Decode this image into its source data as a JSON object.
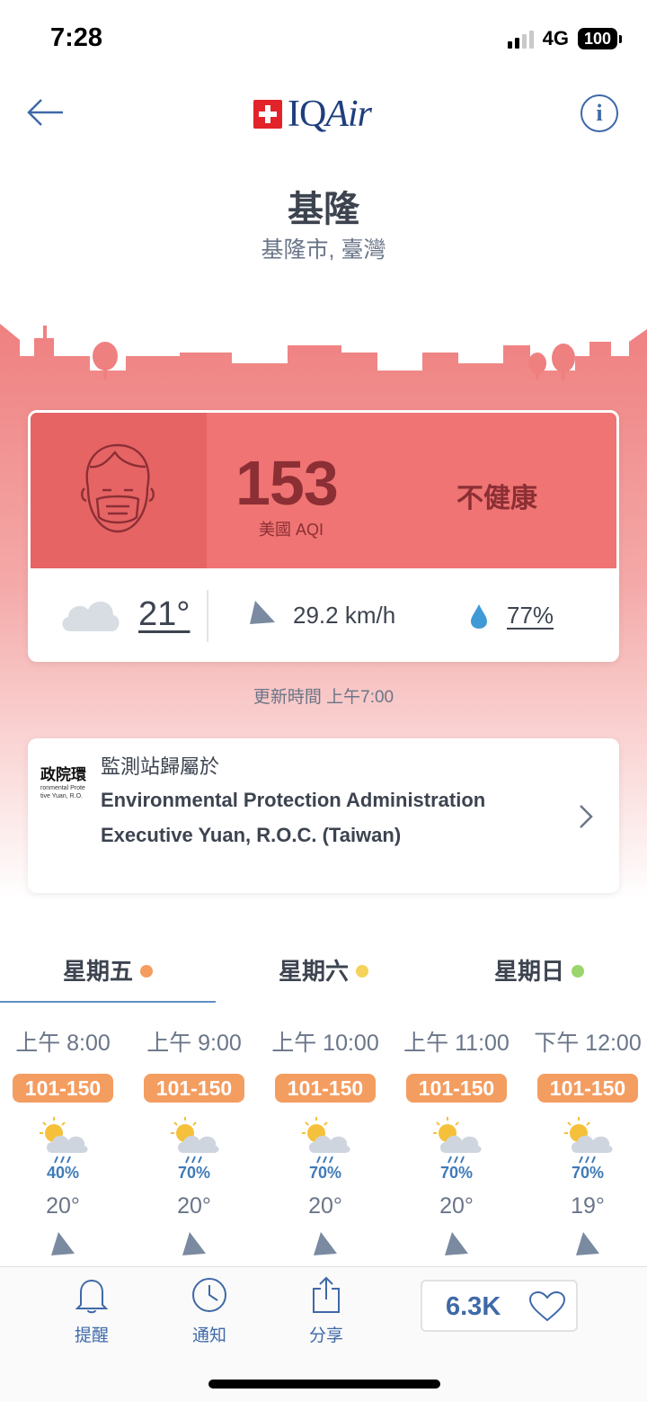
{
  "status_bar": {
    "time": "7:28",
    "network": "4G",
    "battery": "100"
  },
  "header": {
    "logo": "IQAir",
    "logo_prefix": "IQ",
    "logo_suffix": "Air"
  },
  "location": {
    "city": "基隆",
    "region": "基隆市, 臺灣"
  },
  "aqi": {
    "value": "153",
    "label": "美國 AQI",
    "status": "不健康",
    "color": "#ef7473"
  },
  "weather": {
    "temp": "21°",
    "wind": "29.2 km/h",
    "humidity": "77%"
  },
  "updated": "更新時間 上午7:00",
  "station": {
    "owned_label": "監測站歸屬於",
    "name": "Environmental Protection Administration Executive Yuan, R.O.C. (Taiwan)",
    "logo_text": "政院環",
    "logo_sub1": "ronmental Prote",
    "logo_sub2": "tive Yuan, R.O."
  },
  "days": [
    {
      "label": "星期五",
      "dot_color": "#f49d61"
    },
    {
      "label": "星期六",
      "dot_color": "#f5d25a"
    },
    {
      "label": "星期日",
      "dot_color": "#9ad66b"
    }
  ],
  "hourly": [
    {
      "time": "上午 8:00",
      "aqi_range": "101-150",
      "rain": "40%",
      "temp": "20°"
    },
    {
      "time": "上午 9:00",
      "aqi_range": "101-150",
      "rain": "70%",
      "temp": "20°"
    },
    {
      "time": "上午 10:00",
      "aqi_range": "101-150",
      "rain": "70%",
      "temp": "20°"
    },
    {
      "time": "上午 11:00",
      "aqi_range": "101-150",
      "rain": "70%",
      "temp": "20°"
    },
    {
      "time": "下午 12:00",
      "aqi_range": "101-150",
      "rain": "70%",
      "temp": "19°"
    }
  ],
  "bottom_bar": {
    "remind": "提醒",
    "notify": "通知",
    "share": "分享",
    "likes": "6.3K"
  },
  "icons": {
    "back": "arrow-left-icon",
    "info": "info-icon",
    "face": "face-mask-icon",
    "cloud": "cloud-icon",
    "wind": "wind-direction-icon",
    "humidity": "water-drop-icon",
    "chevron": "chevron-right-icon",
    "hour_weather": "sun-cloud-rain-icon",
    "bell": "bell-icon",
    "clock": "clock-icon",
    "share": "share-icon",
    "heart": "heart-icon"
  }
}
